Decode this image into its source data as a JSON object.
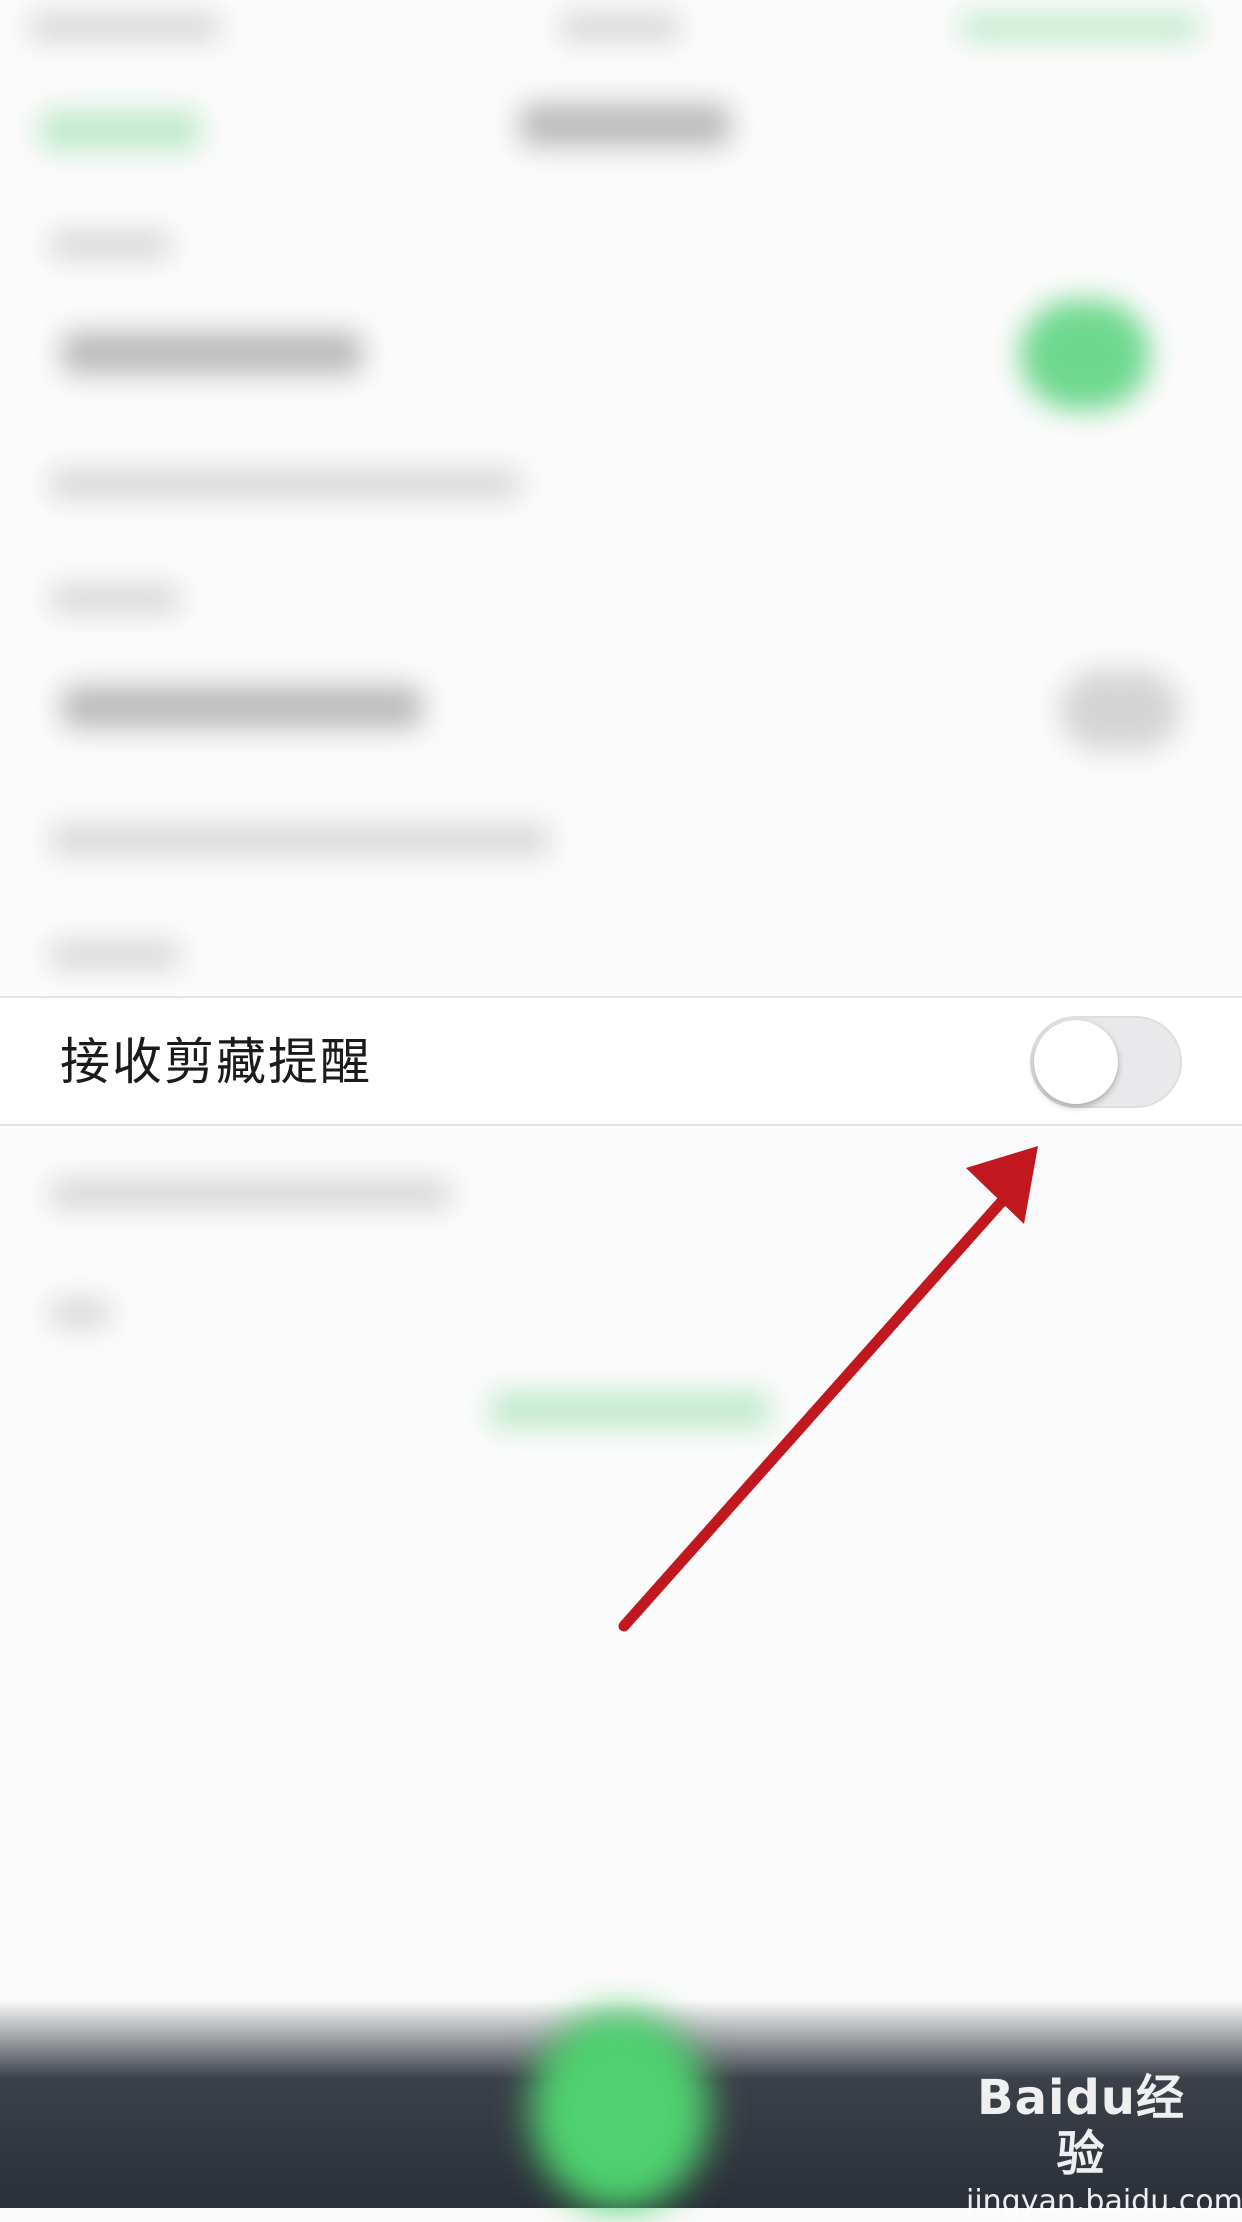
{
  "settings_row": {
    "label": "接收剪藏提醒",
    "toggle_state": "off"
  },
  "watermark": {
    "logo_text": "Baidu经验",
    "url": "jingyan.baidu.com"
  },
  "colors": {
    "annotation_arrow": "#c0181e",
    "toggle_track": "#e9e9eb",
    "toggle_knob": "#ffffff",
    "accent_green": "#4fd16f"
  }
}
